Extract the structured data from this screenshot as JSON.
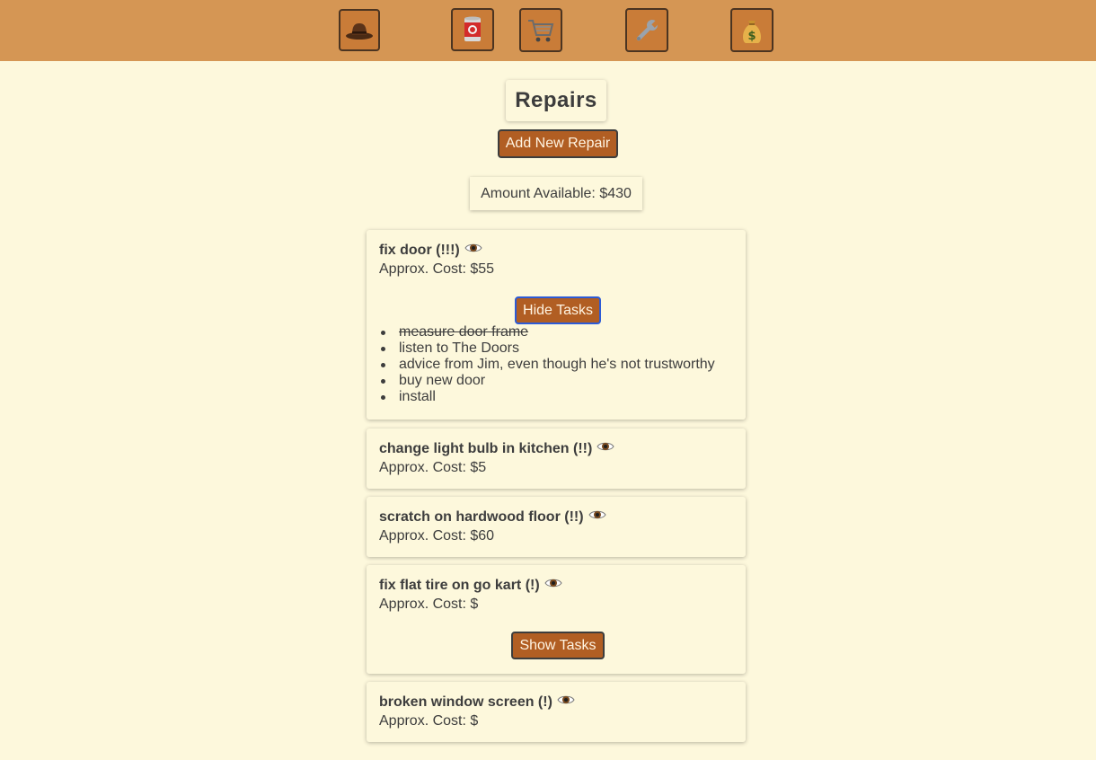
{
  "nav": {
    "items": [
      {
        "name": "cowboy-hat-icon"
      },
      {
        "name": "tin-can-icon"
      },
      {
        "name": "shopping-cart-icon"
      },
      {
        "name": "wrench-icon"
      },
      {
        "name": "money-bag-icon"
      }
    ],
    "colors": {
      "bar": "#d59654",
      "button": "#c97c38"
    }
  },
  "page": {
    "title": "Repairs",
    "add_button": "Add New Repair",
    "amount_available": "Amount Available: $430"
  },
  "repairs": [
    {
      "title": "fix door (!!!)",
      "cost": "Approx. Cost: $55",
      "toggle_label": "Hide Tasks",
      "tasks": [
        {
          "text": "measure door frame",
          "done": true
        },
        {
          "text": "listen to The Doors",
          "done": false
        },
        {
          "text": "advice from Jim, even though he's not trustworthy",
          "done": false
        },
        {
          "text": "buy new door",
          "done": false
        },
        {
          "text": "install",
          "done": false
        }
      ]
    },
    {
      "title": "change light bulb in kitchen (!!)",
      "cost": "Approx. Cost: $5"
    },
    {
      "title": "scratch on hardwood floor (!!)",
      "cost": "Approx. Cost: $60"
    },
    {
      "title": "fix flat tire on go kart (!)",
      "cost": "Approx. Cost: $",
      "toggle_label": "Show Tasks"
    },
    {
      "title": "broken window screen (!)",
      "cost": "Approx. Cost: $"
    }
  ],
  "colors": {
    "background": "#fdf8dc",
    "accent_button": "#b15e23",
    "text": "#3d3d3d"
  }
}
